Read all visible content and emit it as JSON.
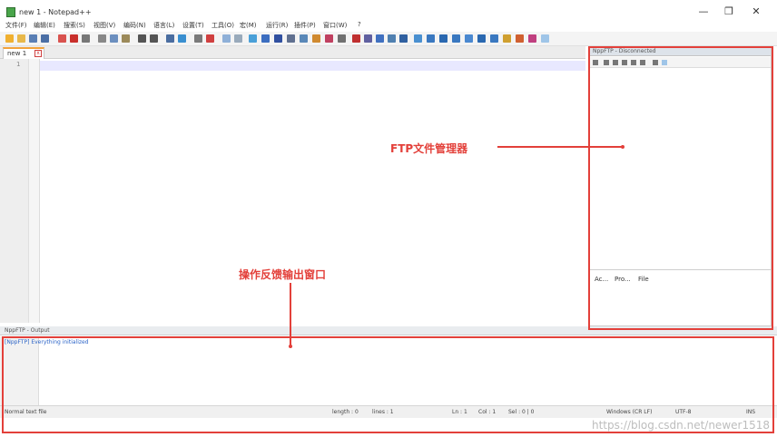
{
  "window": {
    "title": "new 1 - Notepad++",
    "minimize": "—",
    "maximize": "❐",
    "close": "✕"
  },
  "menu": [
    "文件(F)",
    "编辑(E)",
    "搜索(S)",
    "视图(V)",
    "编码(N)",
    "语言(L)",
    "设置(T)",
    "工具(O)",
    "宏(M)",
    "运行(R)",
    "插件(P)",
    "窗口(W)",
    "?"
  ],
  "tab": {
    "label": "new 1",
    "close": "x"
  },
  "editor": {
    "line_number": "1"
  },
  "ftp_panel": {
    "title": "NppFTP - Disconnected",
    "columns": [
      "Ac...",
      "Pro...",
      "File"
    ]
  },
  "output_panel": {
    "title": "NppFTP - Output",
    "log_line": "[NppFTP] Everything initialized"
  },
  "status": {
    "file_type": "Normal text file",
    "length": "length : 0",
    "lines": "lines : 1",
    "ln": "Ln : 1",
    "col": "Col : 1",
    "sel": "Sel : 0 | 0",
    "eol": "Windows (CR LF)",
    "encoding": "UTF-8",
    "ins": "INS"
  },
  "annotations": {
    "ftp": "FTP文件管理器",
    "output": "操作反馈输出窗口",
    "color": "#e3403a"
  },
  "watermark": "https://blog.csdn.net/newer1518"
}
